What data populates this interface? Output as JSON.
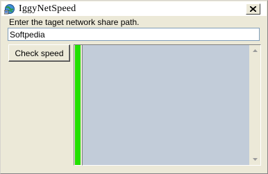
{
  "window": {
    "title": "IggyNetSpeed",
    "app_icon": "globe-network-icon",
    "close_icon": "close-x-icon"
  },
  "form": {
    "prompt": "Enter the taget network share path.",
    "path_value": "Softpedia",
    "check_button_label": "Check speed"
  },
  "meter": {
    "fill_fraction": 1.0,
    "fill_color": "#22e000"
  },
  "graph": {
    "background_color": "#c2ccd9",
    "scroll_up_icon": "scroll-up-arrow-icon",
    "scroll_down_icon": "scroll-down-arrow-icon"
  }
}
